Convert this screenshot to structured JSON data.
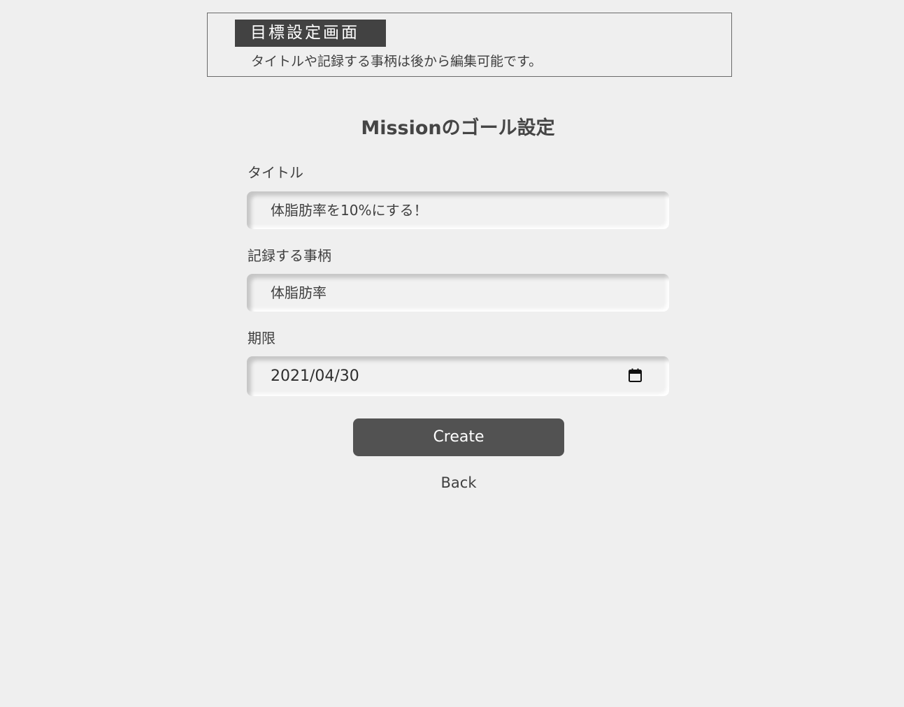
{
  "header": {
    "title": "目標設定画面",
    "description": "タイトルや記録する事柄は後から編集可能です。"
  },
  "form": {
    "heading": "Missionのゴール設定",
    "title_field": {
      "label": "タイトル",
      "value": "体脂肪率を10%にする！"
    },
    "record_field": {
      "label": "記録する事柄",
      "value": "体脂肪率"
    },
    "deadline_field": {
      "label": "期限",
      "value": "2021/04/30",
      "icon": "calendar-icon"
    },
    "create_label": "Create",
    "back_label": "Back"
  },
  "colors": {
    "background": "#efefef",
    "title_bg": "#424242",
    "button_bg": "#525252",
    "text": "#3f3f3f"
  }
}
